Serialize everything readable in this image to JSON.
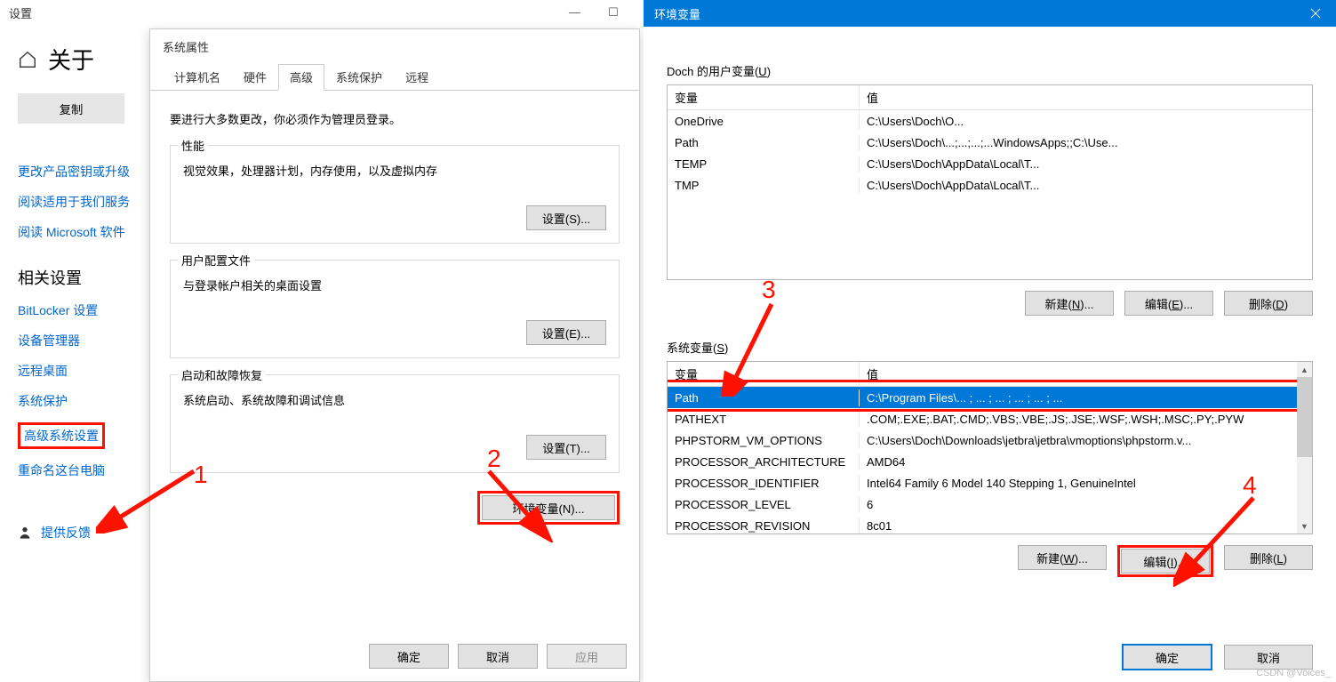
{
  "settings": {
    "window_title": "设置",
    "page_title": "关于",
    "copy_btn": "复制",
    "links_top": [
      "更改产品密钥或升级",
      "阅读适用于我们服务",
      "阅读 Microsoft 软件"
    ],
    "related_header": "相关设置",
    "links_related": [
      "BitLocker 设置",
      "设备管理器",
      "远程桌面",
      "系统保护",
      "高级系统设置",
      "重命名这台电脑"
    ],
    "advanced_index": 4,
    "feedback": "提供反馈"
  },
  "sysprop": {
    "title": "系统属性",
    "tabs": [
      "计算机名",
      "硬件",
      "高级",
      "系统保护",
      "远程"
    ],
    "active_tab": 2,
    "admin_note": "要进行大多数更改，你必须作为管理员登录。",
    "groups": {
      "perf": {
        "legend": "性能",
        "desc": "视觉效果，处理器计划，内存使用，以及虚拟内存",
        "btn": "设置(S)..."
      },
      "profile": {
        "legend": "用户配置文件",
        "desc": "与登录帐户相关的桌面设置",
        "btn": "设置(E)..."
      },
      "startup": {
        "legend": "启动和故障恢复",
        "desc": "系统启动、系统故障和调试信息",
        "btn": "设置(T)..."
      }
    },
    "envvar_btn": "环境变量(N)...",
    "footer": {
      "ok": "确定",
      "cancel": "取消",
      "apply": "应用"
    }
  },
  "envdlg": {
    "title": "环境变量",
    "user_section_label_prefix": "Doch 的用户变量(",
    "user_section_label_key": "U",
    "user_section_label_suffix": ")",
    "sys_section_label_prefix": "系统变量(",
    "sys_section_label_key": "S",
    "sys_section_label_suffix": ")",
    "col_var": "变量",
    "col_val": "值",
    "user_vars": [
      {
        "name": "OneDrive",
        "value": "C:\\Users\\Doch\\O..."
      },
      {
        "name": "Path",
        "value": "C:\\Users\\Doch\\...;...;...;...WindowsApps;;C:\\Use..."
      },
      {
        "name": "TEMP",
        "value": "C:\\Users\\Doch\\AppData\\Local\\T..."
      },
      {
        "name": "TMP",
        "value": "C:\\Users\\Doch\\AppData\\Local\\T..."
      }
    ],
    "sys_vars": [
      {
        "name": "Path",
        "value": "C:\\Program Files\\... ; ... ; ... ; ... ; ... ; ..."
      },
      {
        "name": "PATHEXT",
        "value": ".COM;.EXE;.BAT;.CMD;.VBS;.VBE;.JS;.JSE;.WSF;.WSH;.MSC;.PY;.PYW"
      },
      {
        "name": "PHPSTORM_VM_OPTIONS",
        "value": "C:\\Users\\Doch\\Downloads\\jetbra\\jetbra\\vmoptions\\phpstorm.v..."
      },
      {
        "name": "PROCESSOR_ARCHITECTURE",
        "value": "AMD64"
      },
      {
        "name": "PROCESSOR_IDENTIFIER",
        "value": "Intel64 Family 6 Model 140 Stepping 1, GenuineIntel"
      },
      {
        "name": "PROCESSOR_LEVEL",
        "value": "6"
      },
      {
        "name": "PROCESSOR_REVISION",
        "value": "8c01"
      }
    ],
    "sys_selected": 0,
    "btns_user": {
      "new": "新建(N)...",
      "edit": "编辑(E)...",
      "del": "删除(D)"
    },
    "btns_sys": {
      "new": "新建(W)...",
      "edit": "编辑(I)...",
      "del": "删除(L)"
    },
    "footer": {
      "ok": "确定",
      "cancel": "取消"
    }
  },
  "annotations": {
    "n1": "1",
    "n2": "2",
    "n3": "3",
    "n4": "4"
  },
  "watermark": "CSDN @Voices_"
}
